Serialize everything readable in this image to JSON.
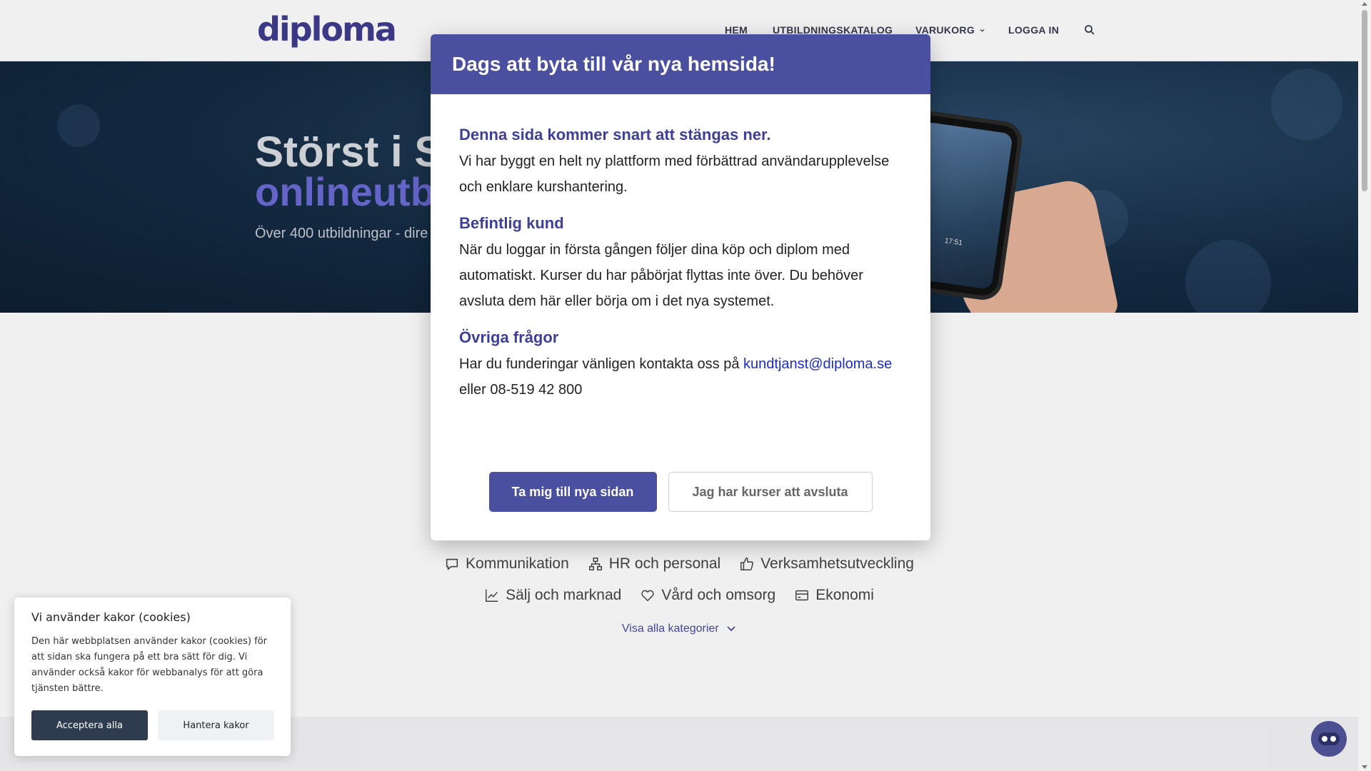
{
  "header": {
    "logo": "diploma",
    "nav": [
      {
        "label": "HEM"
      },
      {
        "label": "UTBILDNINGSKATALOG"
      },
      {
        "label": "VARUKORG"
      },
      {
        "label": "LOGGA IN"
      }
    ],
    "search_icon": "search-icon"
  },
  "hero": {
    "title_line1": "Störst i S",
    "title_line2": "onlineutb",
    "subtitle": "Över 400 utbildningar - dire",
    "video_time": "17:51"
  },
  "categories": {
    "row1": [
      {
        "label": "Kommunikation",
        "icon": "chat-bubble-icon"
      },
      {
        "label": "HR och personal",
        "icon": "org-chart-icon"
      },
      {
        "label": "Verksamhetsutveckling",
        "icon": "thumbs-up-icon"
      }
    ],
    "row2": [
      {
        "label": "Sälj och marknad",
        "icon": "trend-up-icon"
      },
      {
        "label": "Vård och omsorg",
        "icon": "heart-icon"
      },
      {
        "label": "Ekonomi",
        "icon": "credit-card-icon"
      }
    ],
    "show_all": "Visa alla kategorier"
  },
  "modal": {
    "title": "Dags att byta till vår nya hemsida!",
    "section1_heading": "Denna sida kommer snart att stängas ner.",
    "section1_text": "Vi har byggt en helt ny plattform med förbättrad användarupplevelse och enklare kurshantering.",
    "section2_heading": "Befintlig kund",
    "section2_text": "När du loggar in första gången följer dina köp och diplom med automatiskt. Kurser du har påbörjat flyttas inte över. Du behöver avsluta dem här eller börja om i det nya systemet.",
    "section3_heading": "Övriga frågor",
    "section3_text_before": "Har du funderingar vänligen kontakta oss på ",
    "section3_email": "kundtjanst@diploma.se",
    "section3_text_after": "eller 08-519 42 800",
    "primary_button": "Ta mig till nya sidan",
    "secondary_button": "Jag har kurser att avsluta"
  },
  "cookie": {
    "title": "Vi använder kakor (cookies)",
    "text": "Den här webbplatsen använder kakor (cookies) för att sidan ska fungera på ett bra sätt för dig. Vi använder också kakor för webbanalys för att göra tjänsten bättre.",
    "accept_label": "Acceptera alla",
    "manage_label": "Hantera kakor"
  },
  "colors": {
    "brand": "#4a4f9f",
    "link": "#1a2bd0",
    "heading": "#3e3f95"
  }
}
